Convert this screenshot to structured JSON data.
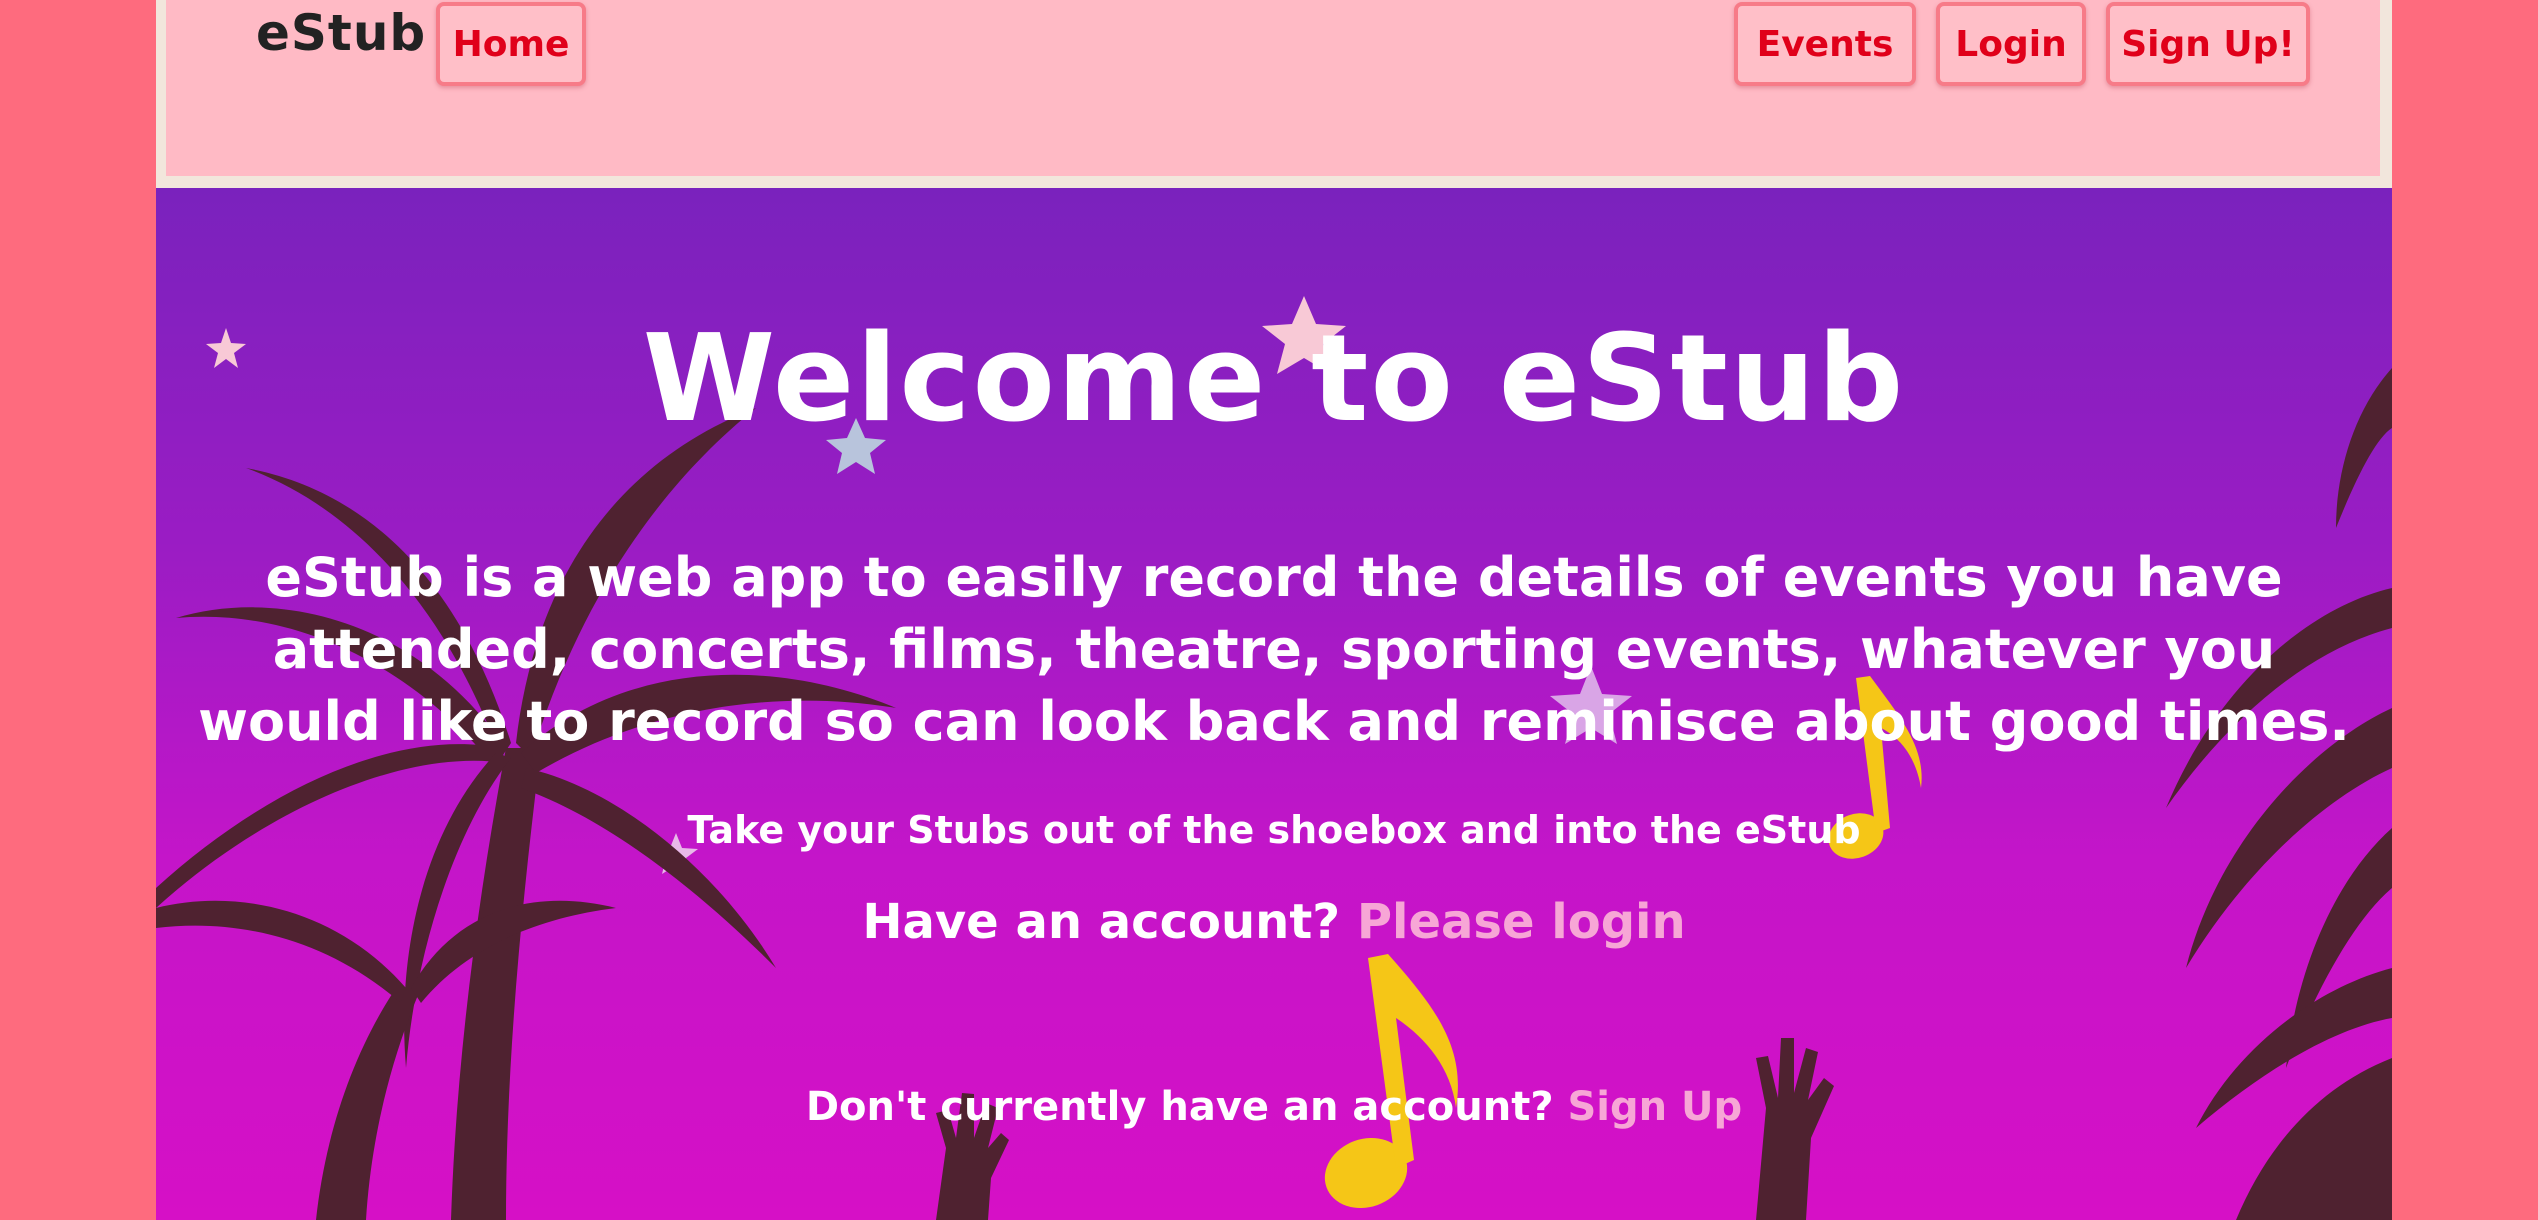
{
  "navbar": {
    "brand": "eStub",
    "home_label": "Home",
    "events_label": "Events",
    "login_label": "Login",
    "signup_label": "Sign Up!"
  },
  "hero": {
    "title": "Welcome to eStub",
    "description": "eStub is a web app to easily record the details of events you have attended, concerts, films, theatre, sporting events, whatever you would like to record so can look back and reminisce about good times.",
    "tagline": "Take your Stubs out of the shoebox and into the eStub",
    "login_prompt": "Have an account?",
    "login_link": "Please login",
    "signup_prompt": "Don't currently have an account?",
    "signup_link": "Sign Up"
  },
  "colors": {
    "page_background": "#fe6b7e",
    "navbar_background": "#ffbac5",
    "nav_button_text": "#e0001a",
    "hero_gradient_top": "#7a22bd",
    "hero_gradient_bottom": "#d610c6",
    "link": "#f7a6d6",
    "note": "#f5c617",
    "palm": "#4f2230"
  }
}
